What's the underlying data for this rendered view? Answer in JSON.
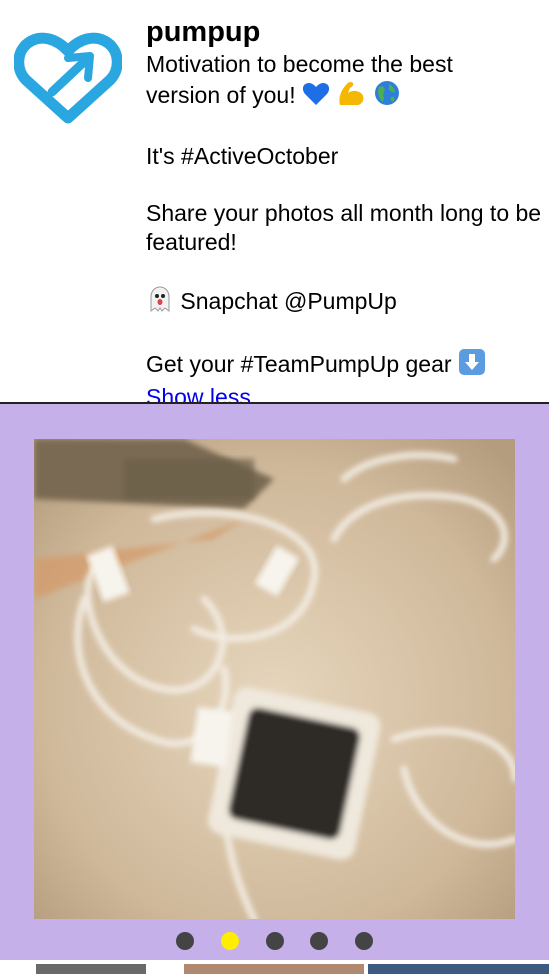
{
  "profile": {
    "name": "pumpup",
    "logo_icon": "pumpup-heart-arrow-logo",
    "bio_line1": "Motivation to become the best",
    "bio_line2": "version of you! ",
    "bio_line2_emojis": [
      "blue-heart",
      "flexed-biceps",
      "globe"
    ],
    "bio_line3": "It's #ActiveOctober",
    "bio_line4": "Share your photos all month long to be featured!",
    "bio_line5_icon": "ghost-icon",
    "bio_line5": " Snapchat @PumpUp",
    "bio_line6": "Get your #TeamPumpUp gear ",
    "bio_line6_icon": "down-arrow-icon",
    "show_less": "Show less"
  },
  "gallery": {
    "background": "#c5b0ea",
    "photo_icon": "earphones-and-ipod-photo",
    "page_count": 5,
    "active_index": 1
  },
  "colors": {
    "logo": "#2aa6e0",
    "link": "#0000ee",
    "dot": "#444444",
    "dot_active": "#ffee00"
  }
}
